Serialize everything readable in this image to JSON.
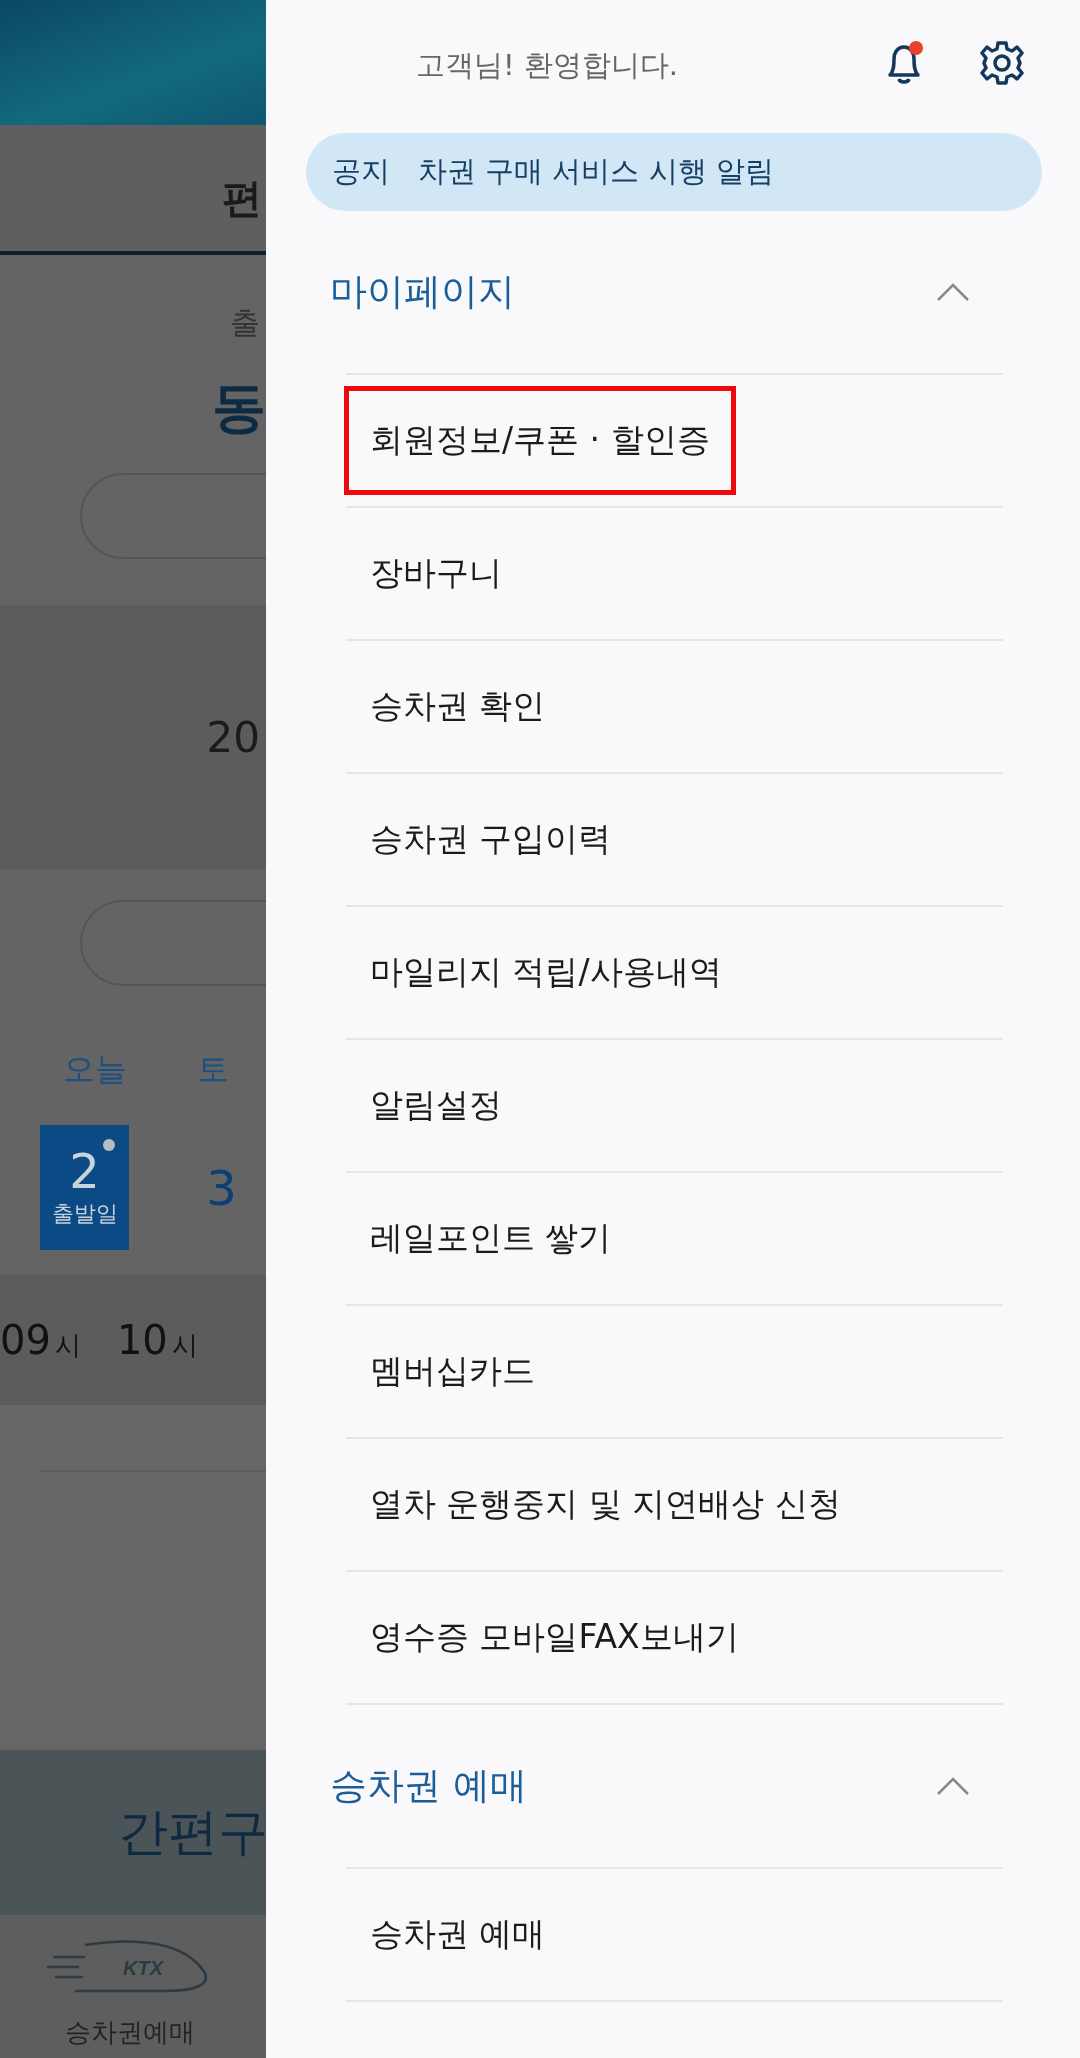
{
  "background": {
    "tab": "편",
    "label": "출",
    "station": "동",
    "date": "20",
    "weekdays": [
      "오늘",
      "토"
    ],
    "days": [
      {
        "day": "2",
        "caption": "출발일",
        "selected": true,
        "dot": true
      },
      {
        "day": "3",
        "selected": false,
        "dot": false
      }
    ],
    "hours": [
      {
        "value": "09",
        "unit": "시"
      },
      {
        "value": "10",
        "unit": "시"
      }
    ],
    "banner_title": "간편구",
    "bottom_nav": [
      {
        "label": "승차권예매",
        "logo_text": "KTX"
      }
    ]
  },
  "drawer": {
    "greeting": "고객님! 환영합니다.",
    "notifications_unread": true,
    "notice": {
      "tag": "공지",
      "text": "차권 구매 서비스 시행 알림"
    },
    "sections": [
      {
        "title": "마이페이지",
        "expanded": true,
        "items": [
          {
            "label": "회원정보/쿠폰 · 할인증",
            "highlighted": true
          },
          {
            "label": "장바구니",
            "highlighted": false
          },
          {
            "label": "승차권 확인",
            "highlighted": false
          },
          {
            "label": "승차권 구입이력",
            "highlighted": false
          },
          {
            "label": "마일리지 적립/사용내역",
            "highlighted": false
          },
          {
            "label": "알림설정",
            "highlighted": false
          },
          {
            "label": "레일포인트 쌓기",
            "highlighted": false
          },
          {
            "label": "멤버십카드",
            "highlighted": false
          },
          {
            "label": "열차 운행중지 및 지연배상 신청",
            "highlighted": false
          },
          {
            "label": "영수증 모바일FAX보내기",
            "highlighted": false
          }
        ]
      },
      {
        "title": "승차권 예매",
        "expanded": true,
        "items": [
          {
            "label": "승차권 예매",
            "highlighted": false
          }
        ]
      }
    ]
  }
}
